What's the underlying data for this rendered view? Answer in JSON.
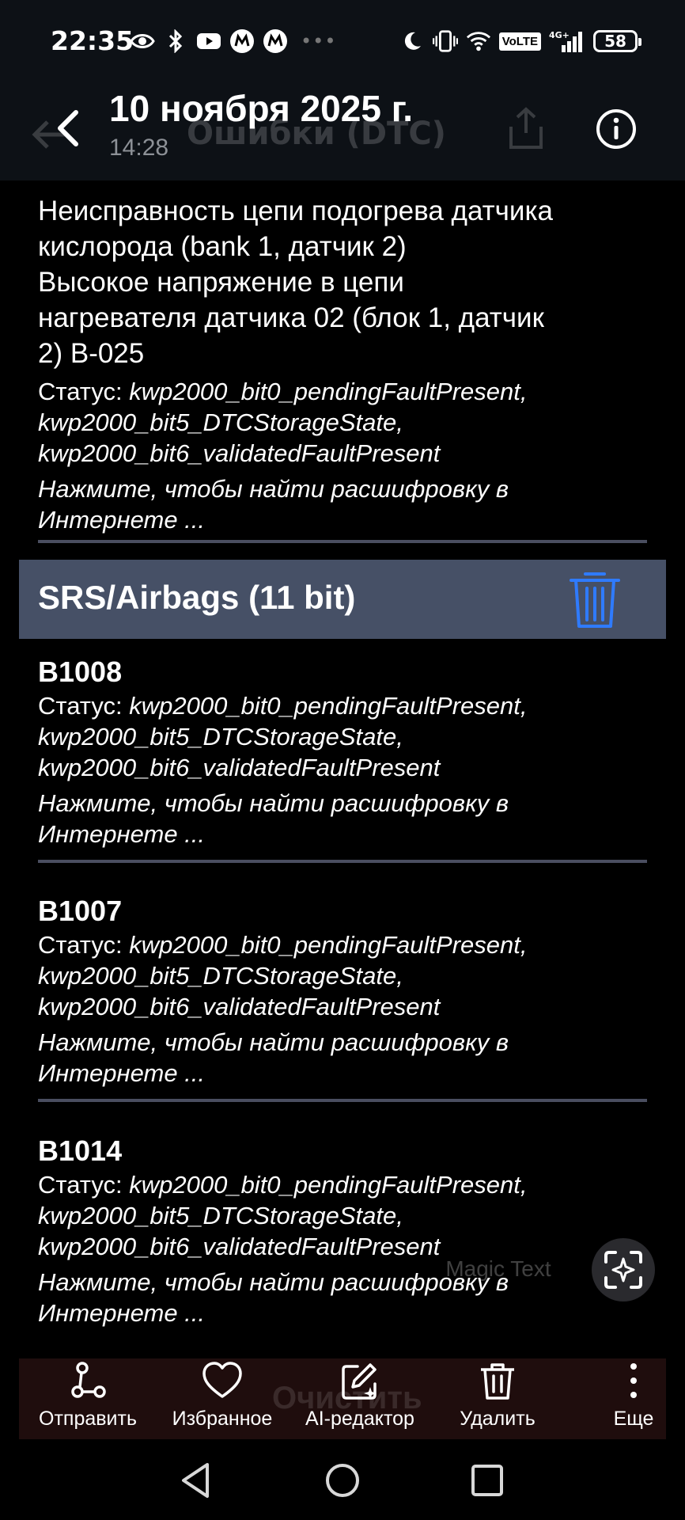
{
  "status_bar": {
    "time": "22:35",
    "battery": "58",
    "network": "4G+",
    "volte": "VoLTE",
    "left_icons": [
      "eye-icon",
      "bluetooth-icon",
      "youtube-icon",
      "m-app-icon",
      "m-app-icon"
    ],
    "right_icons": [
      "moon-icon",
      "vibrate-icon",
      "wifi-icon",
      "volte-icon",
      "signal-icon",
      "battery-icon"
    ]
  },
  "header": {
    "title": "10 ноября 2025 г.",
    "subtitle": "14:28",
    "ghost_title": "Ошибки (DTC)"
  },
  "first_entry": {
    "desc_lines": [
      "Неисправность цепи подогрева датчика",
      "кислорода (bank 1, датчик 2)",
      "Высокое напряжение в цепи",
      "нагревателя датчика 02 (блок 1, датчик",
      "2) B-025"
    ],
    "status_label": "Статус: ",
    "status_lines": [
      "kwp2000_bit0_pendingFaultPresent,",
      "kwp2000_bit5_DTCStorageState,",
      "kwp2000_bit6_validatedFaultPresent"
    ],
    "link_lines": [
      "Нажмите, чтобы найти расшифровку в",
      "Интернете ..."
    ]
  },
  "section": {
    "title": "SRS/Airbags (11 bit)"
  },
  "entries": [
    {
      "code": "B1008",
      "status_label": "Статус: ",
      "status_lines": [
        "kwp2000_bit0_pendingFaultPresent,",
        "kwp2000_bit5_DTCStorageState,",
        "kwp2000_bit6_validatedFaultPresent"
      ],
      "link_lines": [
        "Нажмите, чтобы найти расшифровку в",
        "Интернете ..."
      ]
    },
    {
      "code": "B1007",
      "status_label": "Статус: ",
      "status_lines": [
        "kwp2000_bit0_pendingFaultPresent,",
        "kwp2000_bit5_DTCStorageState,",
        "kwp2000_bit6_validatedFaultPresent"
      ],
      "link_lines": [
        "Нажмите, чтобы найти расшифровку в",
        "Интернете ..."
      ]
    },
    {
      "code": "B1014",
      "status_label": "Статус: ",
      "status_lines": [
        "kwp2000_bit0_pendingFaultPresent,",
        "kwp2000_bit5_DTCStorageState,",
        "kwp2000_bit6_validatedFaultPresent"
      ],
      "link_lines": [
        "Нажмите, чтобы найти расшифровку в",
        "Интернете ..."
      ]
    }
  ],
  "magic_text": "Magic Text",
  "toolbar": {
    "ghost_label": "Очистить",
    "items": [
      {
        "label": "Отправить",
        "icon": "share-icon"
      },
      {
        "label": "Избранное",
        "icon": "heart-icon"
      },
      {
        "label": "AI-редактор",
        "icon": "ai-edit-icon"
      },
      {
        "label": "Удалить",
        "icon": "trash-icon"
      },
      {
        "label": "Еще",
        "icon": "more-vertical-icon"
      }
    ]
  },
  "colors": {
    "header_bg": "#0d1116",
    "section_bg": "#465066",
    "divider": "#4a4e60",
    "trash_blue": "#2f7bff",
    "toolbar_bg": "#1f0d0d"
  }
}
